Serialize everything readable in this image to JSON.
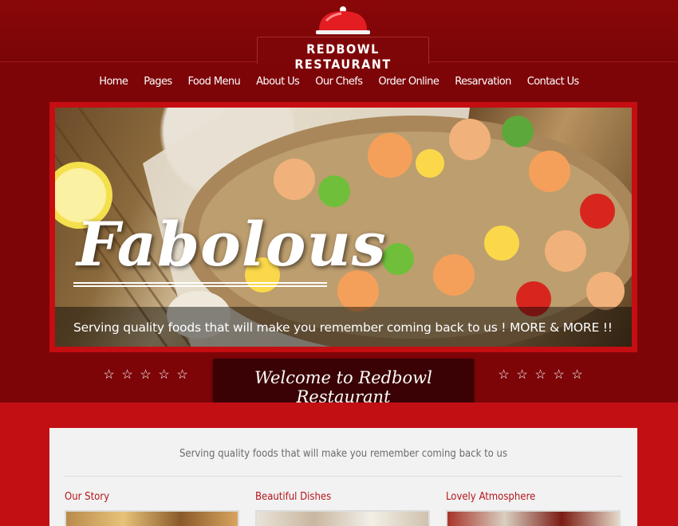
{
  "brand": {
    "name": "REDBOWL RESTAURANT"
  },
  "nav": {
    "items": [
      {
        "label": "Home"
      },
      {
        "label": "Pages"
      },
      {
        "label": "Food Menu"
      },
      {
        "label": "About Us"
      },
      {
        "label": "Our Chefs"
      },
      {
        "label": "Order Online"
      },
      {
        "label": "Resarvation"
      },
      {
        "label": "Contact Us"
      }
    ]
  },
  "hero": {
    "title": "Fabolous",
    "caption": "Serving quality foods that will make you remember coming back to us ! MORE & MORE !!"
  },
  "welcome": {
    "title": "Welcome to Redbowl Restaurant",
    "left_stars": 5,
    "right_stars": 5,
    "star_icon": "☆"
  },
  "content": {
    "tagline": "Serving quality foods that will make you remember coming back to us",
    "columns": [
      {
        "title": "Our Story"
      },
      {
        "title": "Beautiful Dishes"
      },
      {
        "title": "Lovely Atmosphere"
      }
    ]
  },
  "colors": {
    "header_bg": "#7a0507",
    "accent_red": "#c10f14",
    "welcome_bg": "#3a0204",
    "column_title": "#b3161a"
  }
}
